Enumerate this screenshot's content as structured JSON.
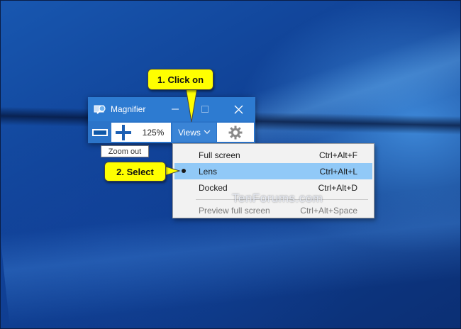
{
  "window": {
    "title": "Magnifier",
    "minimize_icon": "minimize-icon",
    "maximize_icon": "maximize-icon",
    "close_icon": "close-icon"
  },
  "toolbar": {
    "zoom_level": "125%",
    "views_label": "Views",
    "tooltip": "Zoom out"
  },
  "menu": {
    "items": [
      {
        "label": "Full screen",
        "shortcut": "Ctrl+Alt+F",
        "selected": false,
        "enabled": true
      },
      {
        "label": "Lens",
        "shortcut": "Ctrl+Alt+L",
        "selected": true,
        "enabled": true
      },
      {
        "label": "Docked",
        "shortcut": "Ctrl+Alt+D",
        "selected": false,
        "enabled": true
      },
      {
        "label": "Preview full screen",
        "shortcut": "Ctrl+Alt+Space",
        "selected": false,
        "enabled": false
      }
    ]
  },
  "callouts": {
    "step1": "1. Click on",
    "step2": "2. Select"
  },
  "watermark": "TenForums.com",
  "colors": {
    "titlebar": "#2d7bd1",
    "highlight": "#91c9f7",
    "callout": "#ffff00",
    "desktop": "#0f3d8f"
  }
}
